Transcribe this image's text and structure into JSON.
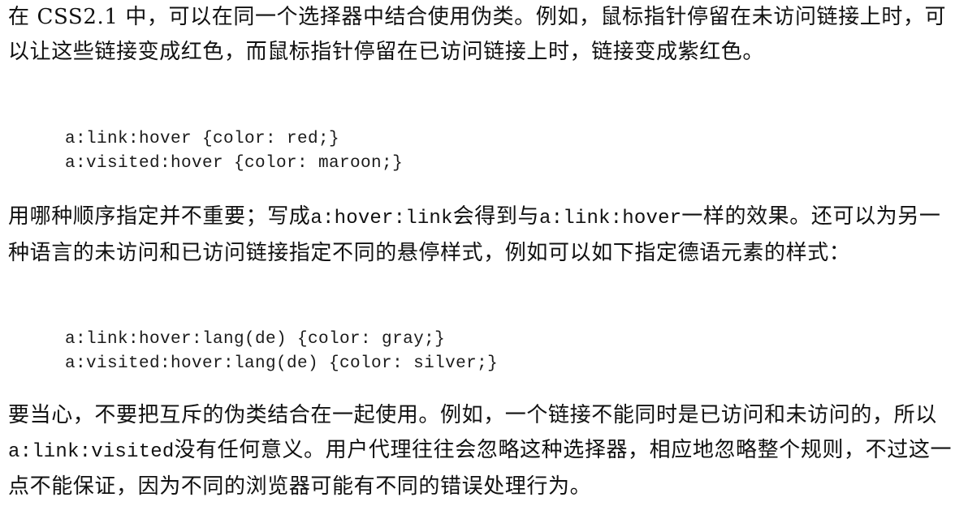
{
  "paragraph1": {
    "text": "在 CSS2.1 中，可以在同一个选择器中结合使用伪类。例如，鼠标指针停留在未访问链接上时，可以让这些链接变成红色，而鼠标指针停留在已访问链接上时，链接变成紫红色。"
  },
  "code_block1": {
    "lines": [
      "a:link:hover {color: red;}",
      "a:visited:hover {color: maroon;}"
    ]
  },
  "paragraph2": {
    "part1": "用哪种顺序指定并不重要；写成",
    "code1": "a:hover:link",
    "part2": "会得到与",
    "code2": "a:link:hover",
    "part3": "一样的效果。还可以为另一种语言的未访问和已访问链接指定不同的悬停样式，例如可以如下指定德语元素的样式："
  },
  "code_block2": {
    "lines": [
      "a:link:hover:lang(de) {color: gray;}",
      "a:visited:hover:lang(de) {color: silver;}"
    ]
  },
  "paragraph3": {
    "part1": "要当心，不要把互斥的伪类结合在一起使用。例如，一个链接不能同时是已访问和未访问的，所以",
    "code1": "a:link:visited",
    "part2": "没有任何意义。用户代理往往会忽略这种选择器，相应地忽略整个规则，不过这一点不能保证，因为不同的浏览器可能有不同的错误处理行为。"
  }
}
